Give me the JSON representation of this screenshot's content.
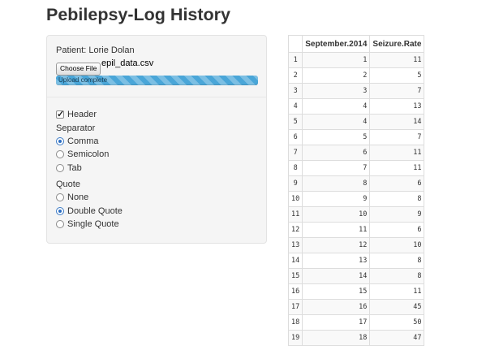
{
  "app": {
    "title": "Pebilepsy-Log History"
  },
  "upload": {
    "patient_label": "Patient: Lorie Dolan",
    "button_label": "Choose File",
    "file_name": "epil_data.csv",
    "progress_text": "Upload complete",
    "progress_fraction": 1.0
  },
  "options": {
    "header": {
      "label": "Header",
      "checked": true
    },
    "separator": {
      "label": "Separator",
      "choices": [
        {
          "label": "Comma",
          "selected": true
        },
        {
          "label": "Semicolon",
          "selected": false
        },
        {
          "label": "Tab",
          "selected": false
        }
      ]
    },
    "quote": {
      "label": "Quote",
      "choices": [
        {
          "label": "None",
          "selected": false
        },
        {
          "label": "Double Quote",
          "selected": true
        },
        {
          "label": "Single Quote",
          "selected": false
        }
      ]
    }
  },
  "table": {
    "columns": [
      "",
      "September.2014",
      "Seizure.Rate"
    ],
    "rows": [
      [
        "1",
        "1",
        "11"
      ],
      [
        "2",
        "2",
        "5"
      ],
      [
        "3",
        "3",
        "7"
      ],
      [
        "4",
        "4",
        "13"
      ],
      [
        "5",
        "4",
        "14"
      ],
      [
        "6",
        "5",
        "7"
      ],
      [
        "7",
        "6",
        "11"
      ],
      [
        "8",
        "7",
        "11"
      ],
      [
        "9",
        "8",
        "6"
      ],
      [
        "10",
        "9",
        "8"
      ],
      [
        "11",
        "10",
        "9"
      ],
      [
        "12",
        "11",
        "6"
      ],
      [
        "13",
        "12",
        "10"
      ],
      [
        "14",
        "13",
        "8"
      ],
      [
        "15",
        "14",
        "8"
      ],
      [
        "16",
        "15",
        "11"
      ],
      [
        "17",
        "16",
        "45"
      ],
      [
        "18",
        "17",
        "50"
      ],
      [
        "19",
        "18",
        "47"
      ]
    ]
  },
  "colors": {
    "progress": "#4aa6d8",
    "radio_selected": "#2d6fc4"
  }
}
